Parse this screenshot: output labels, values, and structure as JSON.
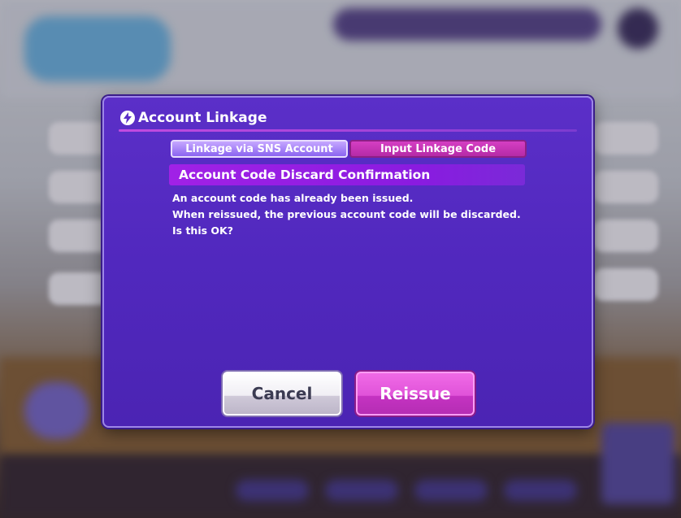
{
  "dialog": {
    "title": "Account Linkage",
    "title_icon": "lightning-icon",
    "tabs": [
      {
        "label": "Linkage via SNS Account",
        "selected": false
      },
      {
        "label": "Input Linkage Code",
        "selected": true
      }
    ],
    "section_header": "Account Code Discard Confirmation",
    "message_lines": [
      "An account code has already been issued.",
      "When reissued, the previous account code will be discarded.",
      "Is this OK?"
    ],
    "cancel_label": "Cancel",
    "reissue_label": "Reissue"
  },
  "colors": {
    "dialog_bg": "#5128be",
    "accent": "#a121e6",
    "reissue": "#e053d9"
  }
}
